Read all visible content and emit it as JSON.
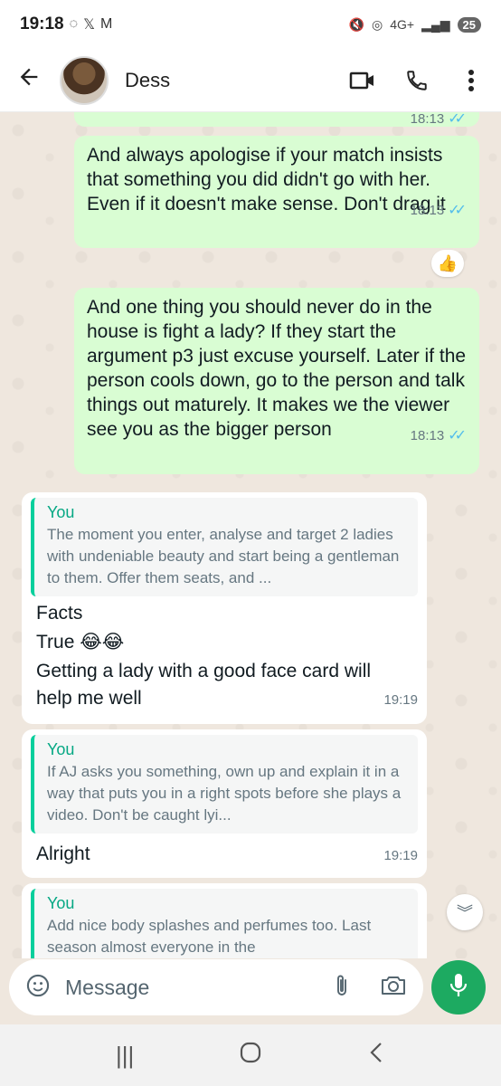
{
  "status_bar": {
    "time": "19:18",
    "battery": "25",
    "network": "4G+"
  },
  "header": {
    "contact_name": "Dess"
  },
  "messages": {
    "top_partial_time": "18:13",
    "out1": {
      "text": "And always apologise if your match insists that something you did didn't go with her. Even if it doesn't make sense. Don't drag it",
      "time": "18:13",
      "reaction": "👍"
    },
    "out2": {
      "text": "And one thing you should never do in the house is fight a lady? If they start the argument p3 just excuse yourself. Later if the person cools down, go to the person and talk things out maturely. It makes we the viewer see you as the bigger person",
      "time": "18:13"
    },
    "in1": {
      "quote_author": "You",
      "quote_text": "The moment you enter, analyse and target 2 ladies with undeniable beauty and start being a gentleman to them. Offer them seats, and ...",
      "line1": "Facts",
      "line2": "True 😂😂",
      "line3": "Getting a lady with a good face card will help me well",
      "time": "19:19"
    },
    "in2": {
      "quote_author": "You",
      "quote_text": "If AJ asks you something, own up and explain it in a way that puts you in a right spots before she plays a video. Don't be caught lyi...",
      "text": "Alright",
      "time": "19:19"
    },
    "in3": {
      "quote_author": "You",
      "quote_text": "Add nice body splashes and perfumes too. Last season almost everyone in the"
    }
  },
  "composer": {
    "placeholder": "Message"
  },
  "icons": {
    "back": "arrow-left-icon",
    "video": "video-call-icon",
    "call": "phone-icon",
    "menu": "more-vert-icon",
    "emoji": "sticker-icon",
    "attach": "paperclip-icon",
    "camera": "camera-icon",
    "mic": "mic-icon"
  },
  "colors": {
    "outgoing_bubble": "#d9fdd3",
    "incoming_bubble": "#ffffff",
    "accent": "#1daa61",
    "quote_bar": "#06cf9c",
    "read_ticks": "#53bdeb"
  }
}
